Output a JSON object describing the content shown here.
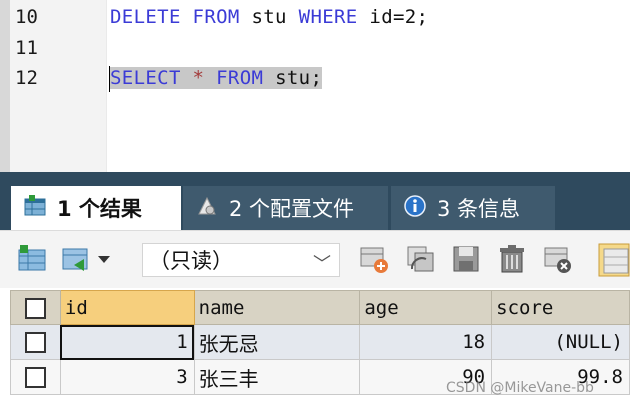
{
  "editor": {
    "lines": [
      {
        "number": "10",
        "tokens": [
          "DELETE",
          "FROM",
          "stu",
          "WHERE",
          "id=2;"
        ]
      },
      {
        "number": "11"
      },
      {
        "number": "12",
        "tokens": [
          "SELECT",
          "*",
          "FROM",
          "stu;"
        ]
      }
    ]
  },
  "tabs": [
    {
      "label": "1 个结果",
      "icon": "result-grid-icon"
    },
    {
      "label": "2 个配置文件",
      "icon": "profile-icon"
    },
    {
      "label": "3 条信息",
      "icon": "info-icon"
    }
  ],
  "toolbar": {
    "mode_select": "（只读）"
  },
  "grid": {
    "columns": [
      "id",
      "name",
      "age",
      "score"
    ],
    "rows": [
      {
        "id": "1",
        "name": "张无忌",
        "age": "18",
        "score": "(NULL)"
      },
      {
        "id": "3",
        "name": "张三丰",
        "age": "90",
        "score": "99.8"
      }
    ]
  },
  "watermark": "CSDN @MikeVane-bb",
  "colors": {
    "keyword": "#3b3bd6",
    "tab_bar": "#2f4a5e",
    "id_header": "#f6cf7d"
  }
}
